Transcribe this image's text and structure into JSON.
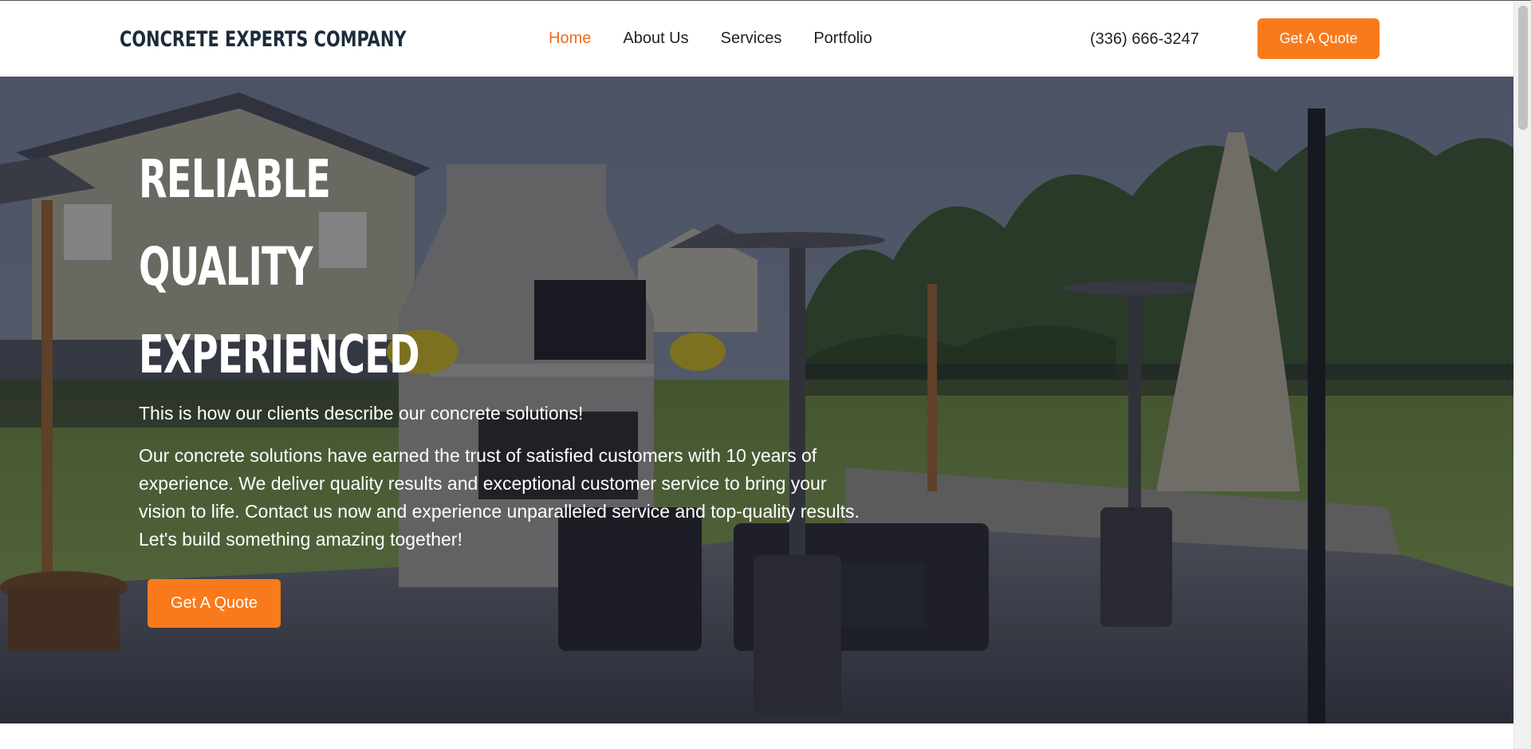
{
  "header": {
    "brand": "CONCRETE EXPERTS COMPANY",
    "nav": [
      {
        "label": "Home",
        "active": true
      },
      {
        "label": "About Us",
        "active": false
      },
      {
        "label": "Services",
        "active": false
      },
      {
        "label": "Portfolio",
        "active": false
      }
    ],
    "phone": "(336) 666-3247",
    "cta_label": "Get A Quote"
  },
  "hero": {
    "headline": [
      "RELIABLE",
      "QUALITY",
      "EXPERIENCED"
    ],
    "tagline": "This is how our clients describe our concrete solutions!",
    "body": "Our concrete solutions have earned the trust of satisfied customers with 10 years of experience. We deliver quality results and exceptional customer service to bring your vision to life. Contact us now and experience unparalleled service and top-quality results. Let's build something amazing together!",
    "cta_label": "Get A Quote",
    "background": "backyard-patio-photo"
  },
  "colors": {
    "accent": "#f97a1c",
    "active_nav": "#f26a1b",
    "brand_text": "#1d2b3a"
  }
}
